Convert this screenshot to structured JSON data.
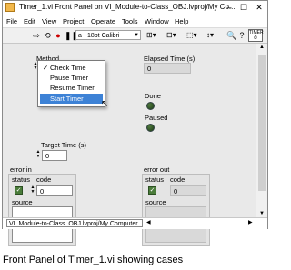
{
  "window": {
    "title": "Timer_1.vi Front Panel on VI_Module-to-Class_OBJ.lvproj/My Co..."
  },
  "menu": [
    "File",
    "Edit",
    "View",
    "Project",
    "Operate",
    "Tools",
    "Window",
    "Help"
  ],
  "toolbar": {
    "font": "18pt Calibri",
    "help_box": "TIMER"
  },
  "panel": {
    "method": {
      "label": "Method"
    },
    "method_options": [
      "Check Time",
      "Pause Timer",
      "Resume Timer",
      "Start Timer"
    ],
    "elapsed": {
      "label": "Elapsed Time (s)",
      "value": "0"
    },
    "done": {
      "label": "Done"
    },
    "paused": {
      "label": "Paused"
    },
    "target": {
      "label": "Target Time (s)",
      "value": "0"
    },
    "error_in": {
      "label": "error in",
      "status": "status",
      "code": "code",
      "code_value": "0",
      "source": "source"
    },
    "error_out": {
      "label": "error out",
      "status": "status",
      "code": "code",
      "code_value": "0",
      "source": "source"
    }
  },
  "statusbar": {
    "path": "VI_Module-to-Class_OBJ.lvproj/My Computer"
  },
  "caption": "Front Panel of Timer_1.vi showing cases"
}
